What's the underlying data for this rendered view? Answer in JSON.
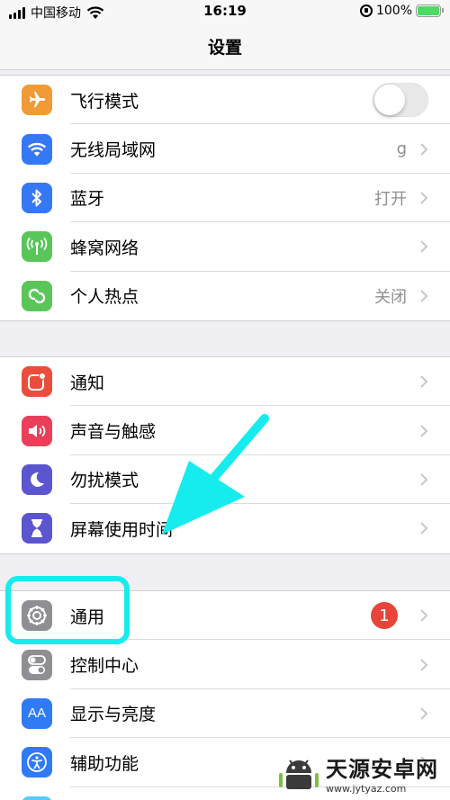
{
  "status": {
    "carrier": "中国移动",
    "time": "16:19",
    "battery_text": "100%"
  },
  "nav": {
    "title": "设置"
  },
  "group1": [
    {
      "label": "飞行模式",
      "icon": "airplane-icon",
      "color": "#f19a38",
      "toggle": false
    },
    {
      "label": "无线局域网",
      "icon": "wifi-icon",
      "color": "#3478f6",
      "value": "g"
    },
    {
      "label": "蓝牙",
      "icon": "bluetooth-icon",
      "color": "#3478f6",
      "value": "打开"
    },
    {
      "label": "蜂窝网络",
      "icon": "cellular-icon",
      "color": "#5ac65a",
      "value": ""
    },
    {
      "label": "个人热点",
      "icon": "hotspot-icon",
      "color": "#5ac65a",
      "value": "关闭"
    }
  ],
  "group2": [
    {
      "label": "通知",
      "icon": "notifications-icon",
      "color": "#eb4d3d"
    },
    {
      "label": "声音与触感",
      "icon": "sound-icon",
      "color": "#ea3f5a"
    },
    {
      "label": "勿扰模式",
      "icon": "moon-icon",
      "color": "#5b56cf"
    },
    {
      "label": "屏幕使用时间",
      "icon": "hourglass-icon",
      "color": "#5b56cf"
    }
  ],
  "group3": [
    {
      "label": "通用",
      "icon": "gear-icon",
      "color": "#8e8e93",
      "badge": "1"
    },
    {
      "label": "控制中心",
      "icon": "toggles-icon",
      "color": "#8e8e93"
    },
    {
      "label": "显示与亮度",
      "icon": "text-size-icon",
      "color": "#2f7bf6",
      "icon_text": "AA"
    },
    {
      "label": "辅助功能",
      "icon": "accessibility-icon",
      "color": "#2f7bf6"
    }
  ],
  "watermark": {
    "title": "天源安卓网",
    "url": "www.jytyaz.com"
  },
  "colors": {
    "annotation": "#16eced",
    "chevron": "#c7c7cc"
  }
}
